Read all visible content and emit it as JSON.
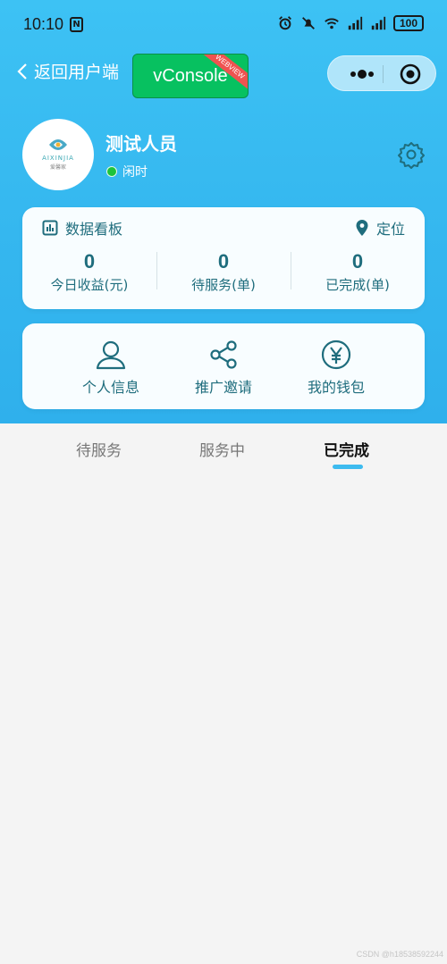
{
  "status_bar": {
    "time": "10:10",
    "nfc": "N",
    "battery": "100"
  },
  "nav": {
    "back_label": "返回用户端",
    "vconsole_label": "vConsole",
    "vconsole_badge": "WEBVIEW"
  },
  "profile": {
    "avatar_brand": "AIXINJIA",
    "avatar_sub": "爱馨家",
    "name": "测试人员",
    "status": "闲时",
    "status_color": "#1dc33b"
  },
  "dashboard": {
    "title": "数据看板",
    "locate_label": "定位",
    "stats": [
      {
        "value": "0",
        "label": "今日收益(元)"
      },
      {
        "value": "0",
        "label": "待服务(单)"
      },
      {
        "value": "0",
        "label": "已完成(单)"
      }
    ]
  },
  "actions": [
    {
      "label": "个人信息",
      "icon": "person-icon"
    },
    {
      "label": "推广邀请",
      "icon": "share-icon"
    },
    {
      "label": "我的钱包",
      "icon": "yuan-icon"
    }
  ],
  "tabs": [
    {
      "label": "待服务",
      "active": false
    },
    {
      "label": "服务中",
      "active": false
    },
    {
      "label": "已完成",
      "active": true
    }
  ],
  "colors": {
    "hero": "#3dc2f4",
    "accent": "#1f6d7d",
    "tab_indicator": "#3dbbef"
  },
  "watermark": "CSDN @h18538592244"
}
